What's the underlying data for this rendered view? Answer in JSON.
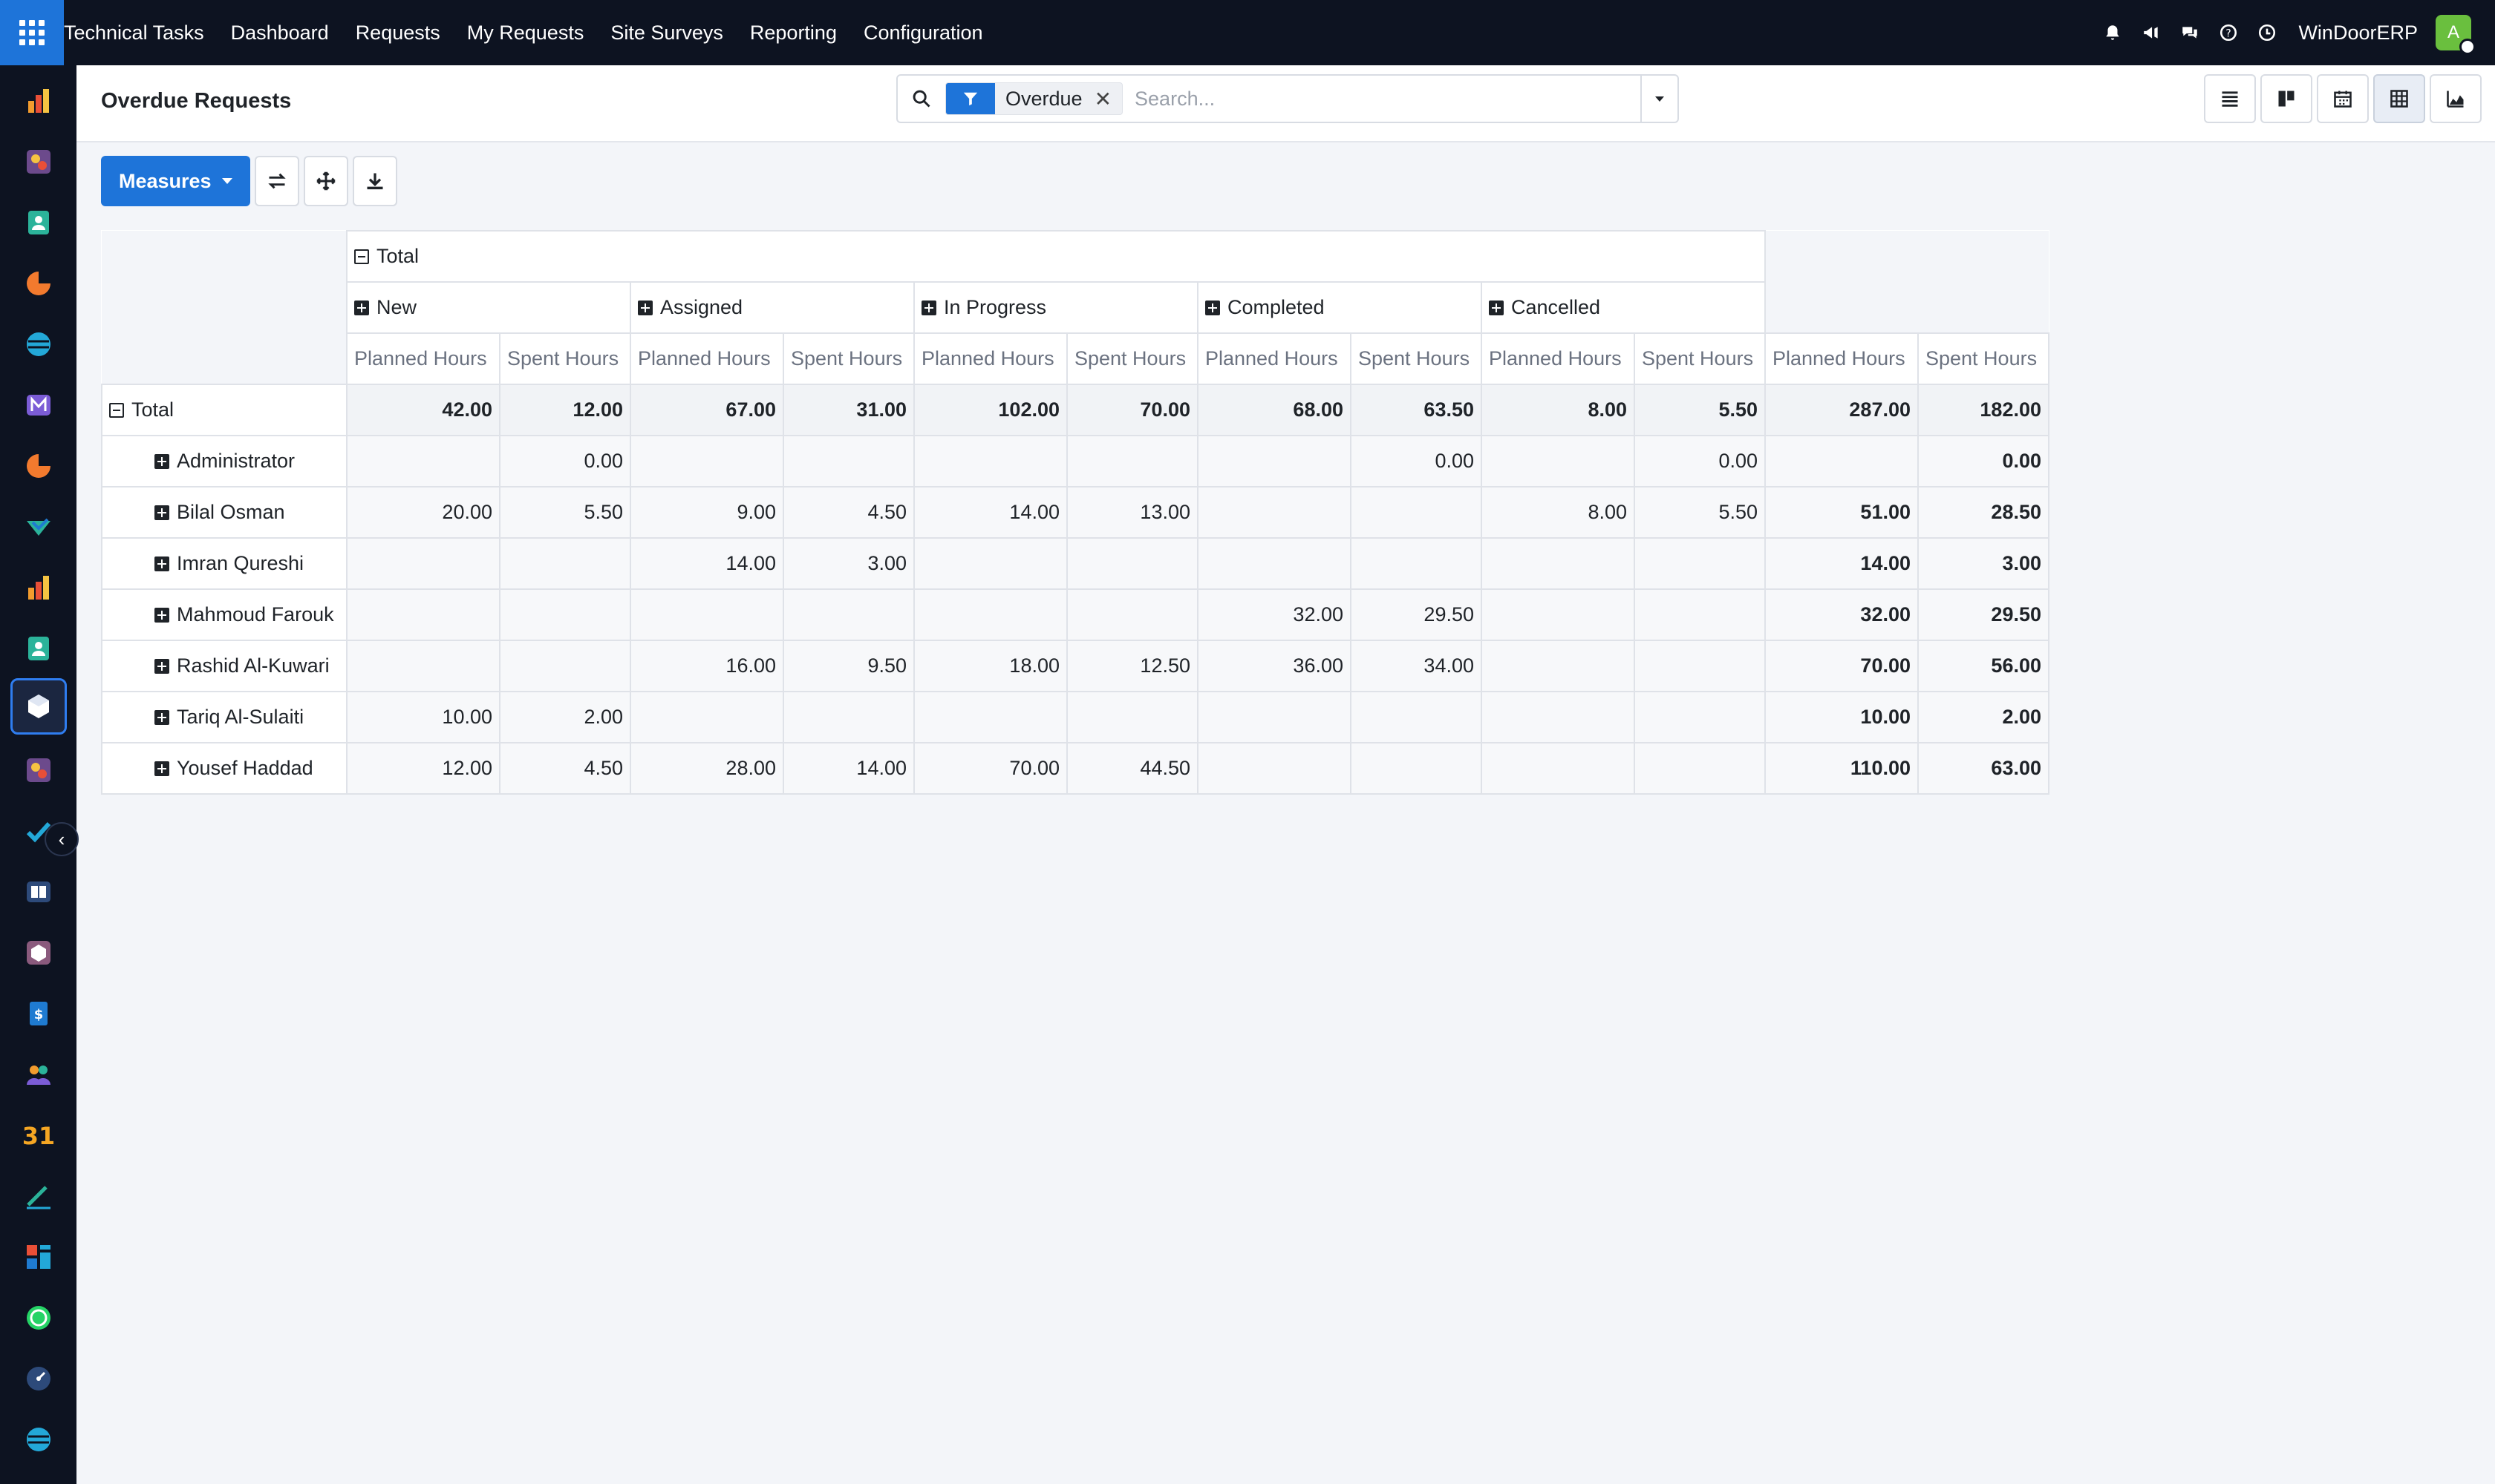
{
  "navbar": {
    "app_name": "Technical Tasks",
    "menu": [
      "Dashboard",
      "Requests",
      "My Requests",
      "Site Surveys",
      "Reporting",
      "Configuration"
    ],
    "company": "WinDoorERP",
    "avatar_letter": "A",
    "icons": [
      "bell-icon",
      "megaphone-icon",
      "chat-icon",
      "help-icon",
      "clock-icon"
    ]
  },
  "rail": {
    "icons": [
      "chart-app-icon",
      "puzzle-app-icon",
      "contacts-app-icon",
      "crm-app-icon",
      "sync-app-icon",
      "mail-app-icon",
      "livechat-app-icon",
      "check-app-icon",
      "chart-app-icon",
      "contacts-app-icon",
      "technical-tasks-app-icon",
      "puzzle-app-icon",
      "todo-app-icon",
      "knowledge-app-icon",
      "inventory-app-icon",
      "invoice-app-icon",
      "employees-app-icon",
      "calendar-app-icon",
      "sign-app-icon",
      "dashboard-app-icon",
      "whatsapp-app-icon",
      "timer-app-icon",
      "sync-app-icon"
    ],
    "calendar_label": "31"
  },
  "control": {
    "title": "Overdue Requests",
    "facet_label": "Overdue",
    "search_placeholder": "Search...",
    "views": [
      "list-view-icon",
      "kanban-view-icon",
      "calendar-view-icon",
      "pivot-view-icon",
      "graph-view-icon"
    ]
  },
  "toolbar": {
    "measures_label": "Measures"
  },
  "pivot": {
    "col_total_label": "Total",
    "groups": [
      "New",
      "Assigned",
      "In Progress",
      "Completed",
      "Cancelled"
    ],
    "measures": [
      "Planned Hours",
      "Spent Hours"
    ],
    "row_total_label": "Total",
    "total_row": [
      "42.00",
      "12.00",
      "67.00",
      "31.00",
      "102.00",
      "70.00",
      "68.00",
      "63.50",
      "8.00",
      "5.50",
      "287.00",
      "182.00"
    ],
    "rows": [
      {
        "name": "Administrator",
        "cells": [
          "",
          "0.00",
          "",
          "",
          "",
          "",
          "",
          "0.00",
          "",
          "0.00",
          "",
          "0.00"
        ]
      },
      {
        "name": "Bilal Osman",
        "cells": [
          "20.00",
          "5.50",
          "9.00",
          "4.50",
          "14.00",
          "13.00",
          "",
          "",
          "8.00",
          "5.50",
          "51.00",
          "28.50"
        ]
      },
      {
        "name": "Imran Qureshi",
        "cells": [
          "",
          "",
          "14.00",
          "3.00",
          "",
          "",
          "",
          "",
          "",
          "",
          "14.00",
          "3.00"
        ]
      },
      {
        "name": "Mahmoud Farouk",
        "cells": [
          "",
          "",
          "",
          "",
          "",
          "",
          "32.00",
          "29.50",
          "",
          "",
          "32.00",
          "29.50"
        ]
      },
      {
        "name": "Rashid Al-Kuwari",
        "cells": [
          "",
          "",
          "16.00",
          "9.50",
          "18.00",
          "12.50",
          "36.00",
          "34.00",
          "",
          "",
          "70.00",
          "56.00"
        ]
      },
      {
        "name": "Tariq Al-Sulaiti",
        "cells": [
          "10.00",
          "2.00",
          "",
          "",
          "",
          "",
          "",
          "",
          "",
          "",
          "10.00",
          "2.00"
        ]
      },
      {
        "name": "Yousef Haddad",
        "cells": [
          "12.00",
          "4.50",
          "28.00",
          "14.00",
          "70.00",
          "44.50",
          "",
          "",
          "",
          "",
          "110.00",
          "63.00"
        ]
      }
    ]
  },
  "colors": {
    "navbar": "#0d1321",
    "accent": "#1e74d9",
    "avatar": "#6abf3e",
    "background": "#f3f5f9"
  }
}
